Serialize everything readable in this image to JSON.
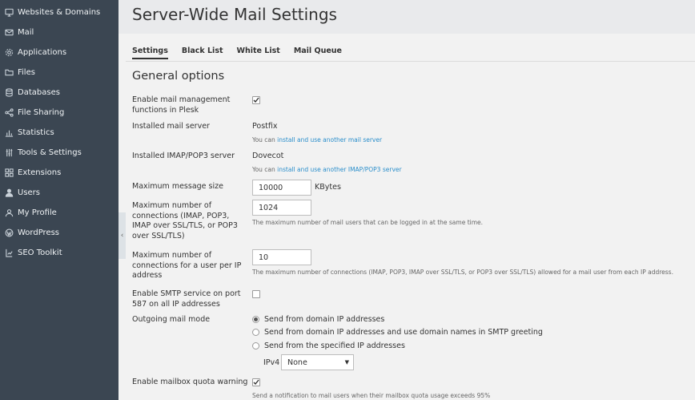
{
  "sidebar": {
    "items": [
      {
        "label": "Websites & Domains",
        "icon": "monitor-icon"
      },
      {
        "label": "Mail",
        "icon": "mail-icon"
      },
      {
        "label": "Applications",
        "icon": "gear-icon"
      },
      {
        "label": "Files",
        "icon": "folder-icon"
      },
      {
        "label": "Databases",
        "icon": "database-icon"
      },
      {
        "label": "File Sharing",
        "icon": "share-icon"
      },
      {
        "label": "Statistics",
        "icon": "bar-chart-icon"
      },
      {
        "label": "Tools & Settings",
        "icon": "sliders-icon"
      },
      {
        "label": "Extensions",
        "icon": "puzzle-icon"
      },
      {
        "label": "Users",
        "icon": "user-icon"
      },
      {
        "label": "My Profile",
        "icon": "profile-icon"
      },
      {
        "label": "WordPress",
        "icon": "wordpress-icon"
      },
      {
        "label": "SEO Toolkit",
        "icon": "seo-icon"
      }
    ],
    "collapse_glyph": "‹"
  },
  "page": {
    "title": "Server-Wide Mail Settings"
  },
  "tabs": [
    {
      "label": "Settings",
      "active": true
    },
    {
      "label": "Black List",
      "active": false
    },
    {
      "label": "White List",
      "active": false
    },
    {
      "label": "Mail Queue",
      "active": false
    }
  ],
  "section": {
    "title": "General options"
  },
  "form": {
    "enable_mail_mgmt": {
      "label": "Enable mail management functions in Plesk",
      "checked": true
    },
    "mail_server": {
      "label": "Installed mail server",
      "value": "Postfix",
      "hint_prefix": "You can ",
      "hint_link": "install and use another mail server"
    },
    "imap_server": {
      "label": "Installed IMAP/POP3 server",
      "value": "Dovecot",
      "hint_prefix": "You can ",
      "hint_link": "install and use another IMAP/POP3 server"
    },
    "max_message_size": {
      "label": "Maximum message size",
      "value": "10000",
      "unit": "KBytes"
    },
    "max_connections": {
      "label": "Maximum number of connections (IMAP, POP3, IMAP over SSL/TLS, or POP3 over SSL/TLS)",
      "value": "1024",
      "hint": "The maximum number of mail users that can be logged in at the same time."
    },
    "max_conn_per_ip": {
      "label": "Maximum number of connections for a user per IP address",
      "value": "10",
      "hint": "The maximum number of connections (IMAP, POP3, IMAP over SSL/TLS, or POP3 over SSL/TLS) allowed for a mail user from each IP address."
    },
    "smtp_587": {
      "label": "Enable SMTP service on port 587 on all IP addresses",
      "checked": false
    },
    "outgoing_mode": {
      "label": "Outgoing mail mode",
      "options": [
        {
          "label": "Send from domain IP addresses",
          "selected": true
        },
        {
          "label": "Send from domain IP addresses and use domain names in SMTP greeting",
          "selected": false
        },
        {
          "label": "Send from the specified IP addresses",
          "selected": false
        }
      ],
      "ipv4_label": "IPv4",
      "ipv4_value": "None"
    },
    "quota_warning": {
      "label": "Enable mailbox quota warning",
      "checked": true,
      "hint": "Send a notification to mail users when their mailbox quota usage exceeds 95%"
    }
  },
  "colors": {
    "sidebar_bg": "#3b4652",
    "link": "#2a8ecb",
    "header_bg": "#e9eaec"
  }
}
